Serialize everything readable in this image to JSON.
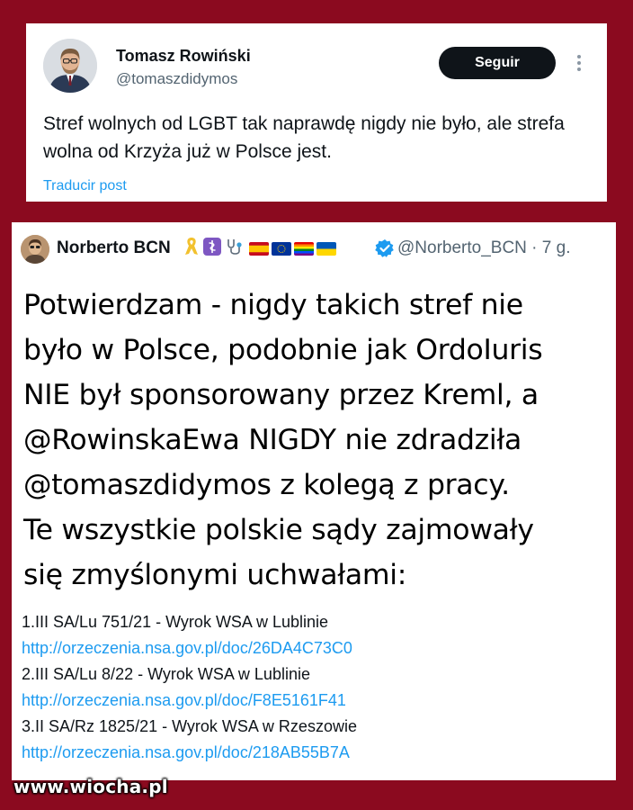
{
  "tweet1": {
    "author_name": "Tomasz Rowiński",
    "author_handle": "@tomaszdidymos",
    "follow_label": "Seguir",
    "text": "Stref wolnych od LGBT tak naprawdę nigdy nie było, ale strefa wolna od Krzyża już w Polsce jest.",
    "translate_label": "Traducir post"
  },
  "tweet2": {
    "author_name": "Norberto BCN",
    "author_handle": "@Norberto_BCN · 7 g.",
    "emojis": [
      "🎗️",
      "⚕️",
      "🩺"
    ],
    "flags": [
      "spain",
      "eu",
      "rainbow",
      "ukraine"
    ],
    "text_lines": [
      "Potwierdzam - nigdy takich stref nie",
      "było w Polsce, podobnie jak OrdoIuris",
      "NIE był sponsorowany przez Kreml, a",
      "@RowinskaEwa NIGDY nie zdradziła",
      "@tomaszdidymos z kolegą z pracy.",
      "Te wszystkie polskie sądy zajmowały",
      "się zmyślonymi uchwałami:"
    ],
    "rulings": [
      {
        "case": "1.III SA/Lu 751/21 - Wyrok WSA w Lublinie",
        "url": "http://orzeczenia.nsa.gov.pl/doc/26DA4C73C0"
      },
      {
        "case": "2.III SA/Lu 8/22 - Wyrok WSA w Lublinie",
        "url": "http://orzeczenia.nsa.gov.pl/doc/F8E5161F41"
      },
      {
        "case": "3.II SA/Rz 1825/21 - Wyrok WSA w Rzeszowie",
        "url": "http://orzeczenia.nsa.gov.pl/doc/218AB55B7A"
      }
    ]
  },
  "watermark": "www.wiocha.pl",
  "colors": {
    "background": "#8b0a1f",
    "link": "#1d9bf0",
    "follow_button": "#0f1419",
    "verified": "#1d9bf0"
  }
}
